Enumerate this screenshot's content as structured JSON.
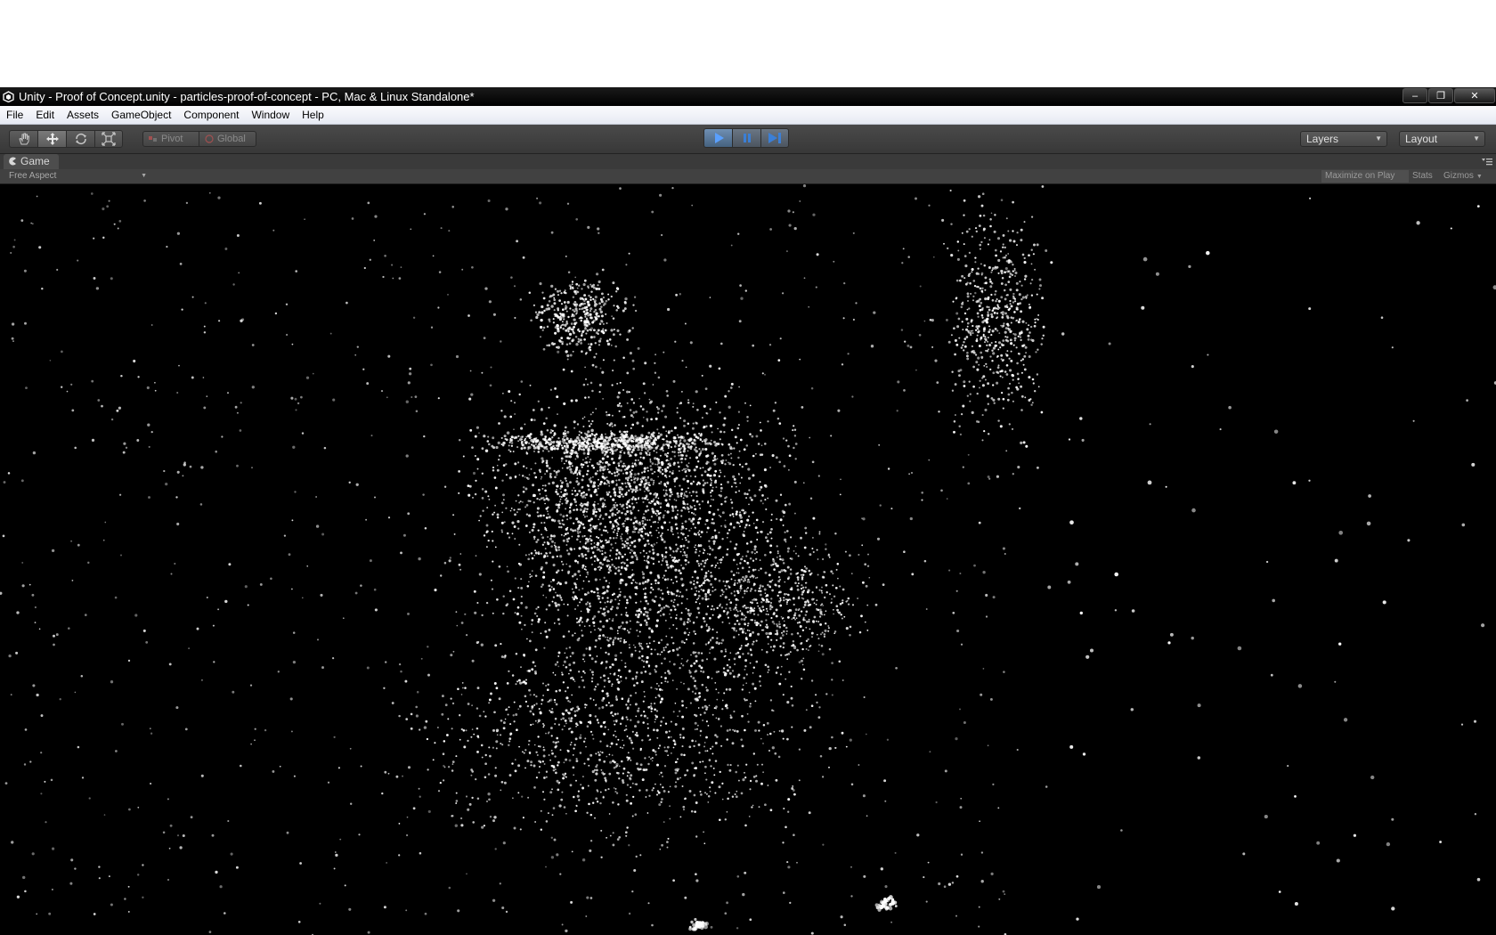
{
  "window": {
    "title": "Unity - Proof of Concept.unity - particles-proof-of-concept - PC, Mac & Linux Standalone*",
    "controls": [
      "minimize-icon",
      "restore-icon",
      "close-icon"
    ]
  },
  "menubar": {
    "items": [
      "File",
      "Edit",
      "Assets",
      "GameObject",
      "Component",
      "Window",
      "Help"
    ]
  },
  "toolbar": {
    "tools": [
      "hand-icon",
      "move-icon",
      "rotate-icon",
      "scale-icon"
    ],
    "active_tool": "move-icon",
    "pivot_label": "Pivot",
    "global_label": "Global",
    "playback": [
      "play-icon",
      "pause-icon",
      "step-icon"
    ],
    "play_active": true,
    "layers_label": "Layers",
    "layout_label": "Layout",
    "accent_color": "#5aa0ff"
  },
  "game_panel": {
    "tab_label": "Game",
    "aspect_label": "Free Aspect",
    "maximize_label": "Maximize on Play",
    "stats_label": "Stats",
    "gizmos_label": "Gizmos"
  }
}
